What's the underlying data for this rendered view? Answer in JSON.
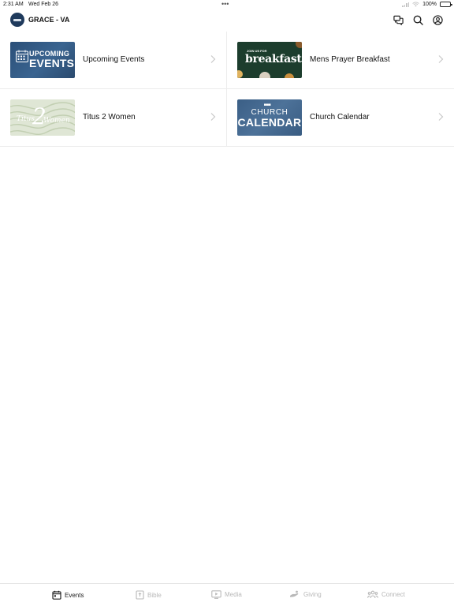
{
  "status_bar": {
    "time": "2:31 AM",
    "date": "Wed Feb 26",
    "battery": "100%"
  },
  "header": {
    "title": "GRACE - VA",
    "actions": [
      "chat-icon",
      "search-icon",
      "profile-icon"
    ]
  },
  "items": [
    {
      "label": "Upcoming Events",
      "thumbnail": {
        "line1": "UPCOMING",
        "line2": "EVENTS"
      }
    },
    {
      "label": "Mens Prayer Breakfast",
      "thumbnail": {
        "line1": "JOIN US FOR",
        "line2": "breakfast"
      }
    },
    {
      "label": "Titus 2 Women",
      "thumbnail": {
        "line1": "Titus",
        "line2": "2",
        "line3": "Women"
      }
    },
    {
      "label": "Church Calendar",
      "thumbnail": {
        "line1": "CHURCH",
        "line2": "CALENDAR"
      }
    }
  ],
  "tabs": [
    {
      "label": "Events",
      "icon": "calendar-icon",
      "active": true
    },
    {
      "label": "Bible",
      "icon": "bible-icon",
      "active": false
    },
    {
      "label": "Media",
      "icon": "media-icon",
      "active": false
    },
    {
      "label": "Giving",
      "icon": "giving-icon",
      "active": false
    },
    {
      "label": "Connect",
      "icon": "connect-icon",
      "active": false
    }
  ],
  "colors": {
    "active_tab": "#222222",
    "inactive_tab": "#b8b8b8",
    "divider": "#ececec"
  }
}
